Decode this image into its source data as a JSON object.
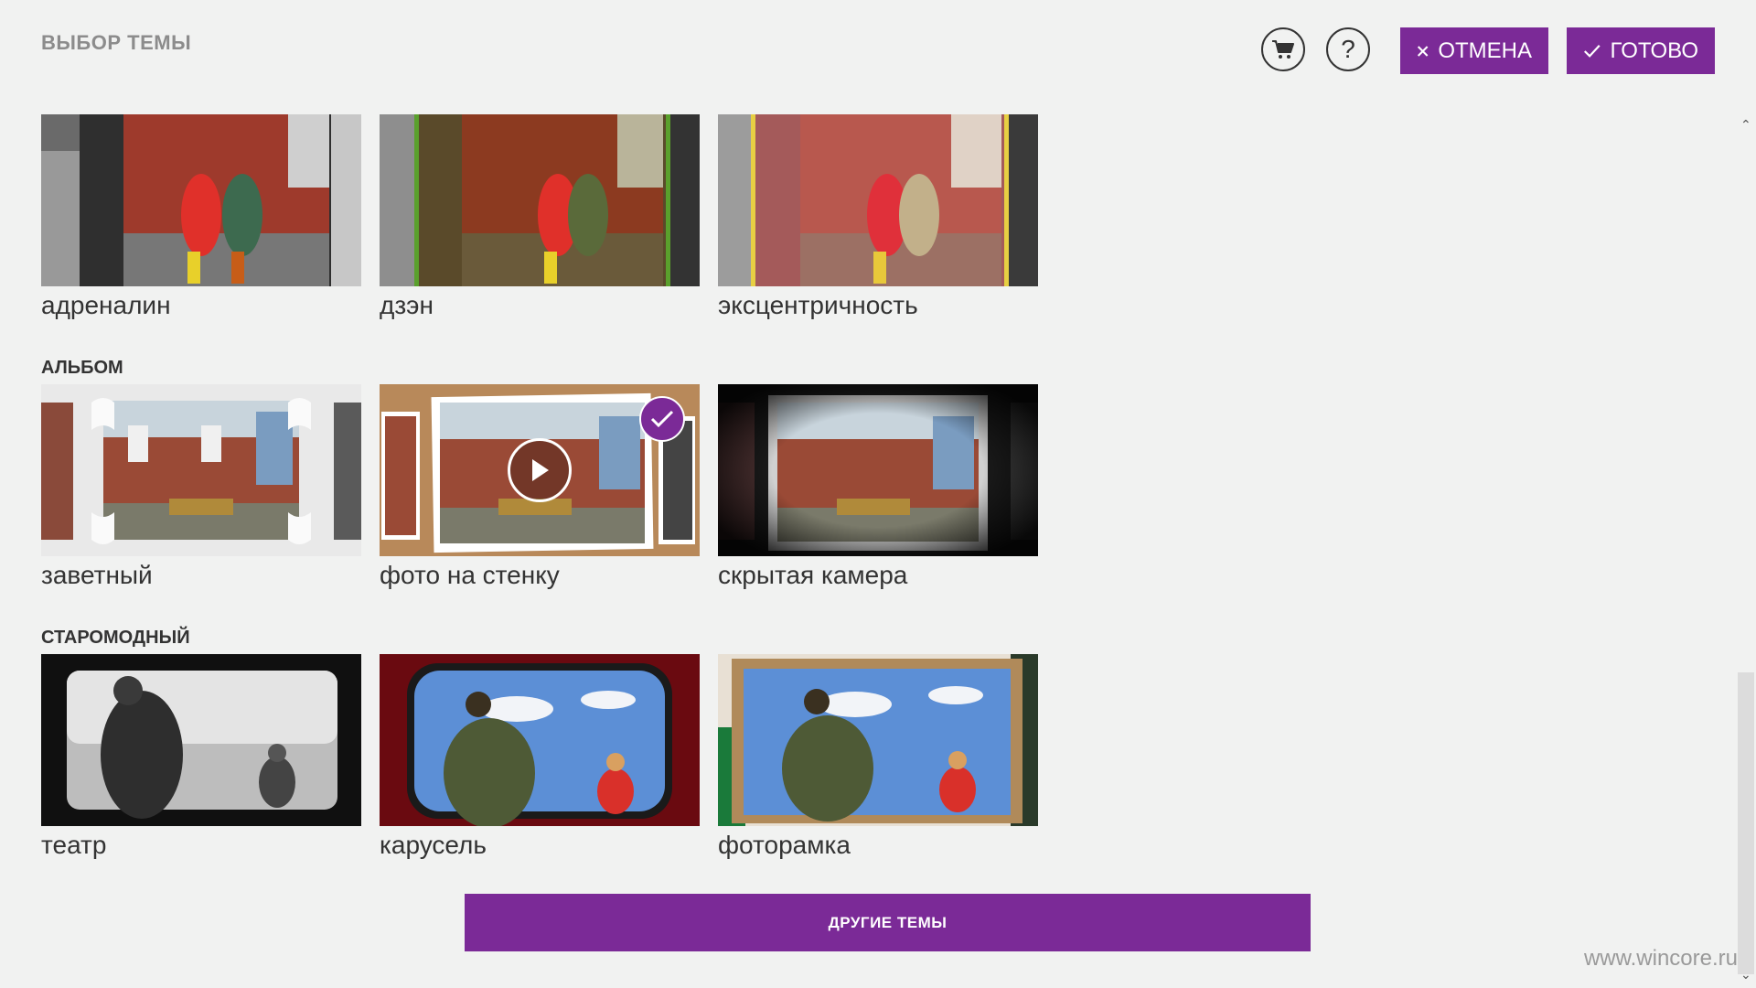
{
  "header": {
    "title": "ВЫБОР ТЕМЫ",
    "cancel_label": "ОТМЕНА",
    "done_label": "ГОТОВО",
    "help_label": "?"
  },
  "sections": [
    {
      "title": "",
      "tiles": [
        {
          "label": "адреналин"
        },
        {
          "label": "дзэн"
        },
        {
          "label": "эксцентричность"
        }
      ]
    },
    {
      "title": "АЛЬБОМ",
      "tiles": [
        {
          "label": "заветный"
        },
        {
          "label": "фото на стенку",
          "selected": true
        },
        {
          "label": "скрытая камера"
        }
      ]
    },
    {
      "title": "СТАРОМОДНЫЙ",
      "tiles": [
        {
          "label": "театр"
        },
        {
          "label": "карусель"
        },
        {
          "label": "фоторамка"
        }
      ]
    }
  ],
  "more_themes_label": "ДРУГИЕ ТЕМЫ",
  "watermark": "www.wincore.ru",
  "colors": {
    "accent": "#7b2a97",
    "background": "#f1f2f1"
  },
  "icons": {
    "cart": "cart-icon",
    "help": "question-icon",
    "cancel": "close-icon",
    "done": "check-icon",
    "selected": "check-icon",
    "play": "play-icon"
  }
}
